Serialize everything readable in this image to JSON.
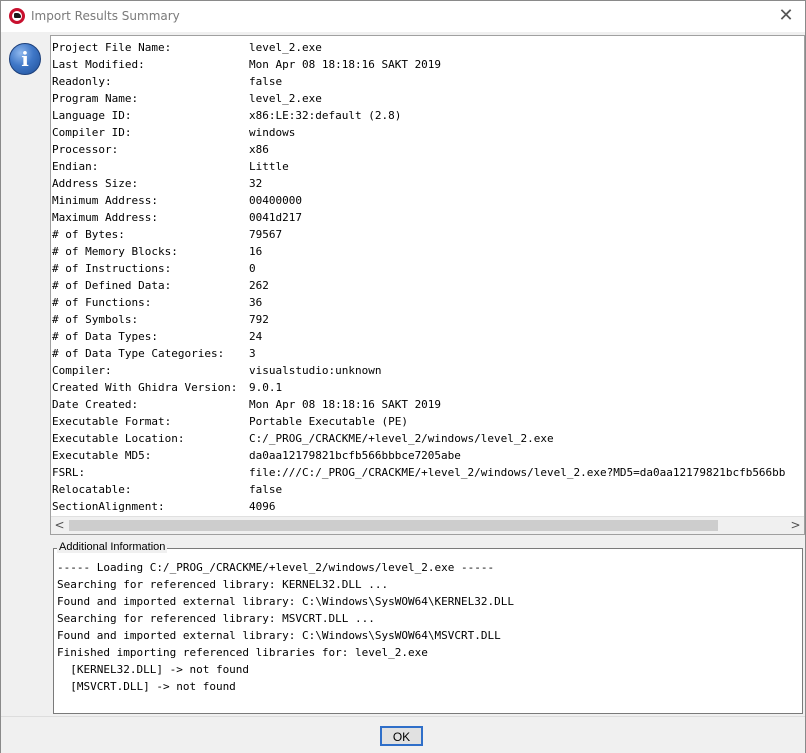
{
  "window": {
    "title": "Import Results Summary",
    "close_glyph": "✕",
    "icon": "ghidra-dragon-icon"
  },
  "info_icon_glyph": "i",
  "properties": [
    {
      "key": "Project File Name:",
      "value": "level_2.exe"
    },
    {
      "key": "Last Modified:",
      "value": "Mon Apr 08 18:18:16 SAKT 2019"
    },
    {
      "key": "Readonly:",
      "value": "false"
    },
    {
      "key": "Program Name:",
      "value": "level_2.exe"
    },
    {
      "key": "Language ID:",
      "value": "x86:LE:32:default (2.8)"
    },
    {
      "key": "Compiler ID:",
      "value": "windows"
    },
    {
      "key": "Processor:",
      "value": "x86"
    },
    {
      "key": "Endian:",
      "value": "Little"
    },
    {
      "key": "Address Size:",
      "value": "32"
    },
    {
      "key": "Minimum Address:",
      "value": "00400000"
    },
    {
      "key": "Maximum Address:",
      "value": "0041d217"
    },
    {
      "key": "# of Bytes:",
      "value": "79567"
    },
    {
      "key": "# of Memory Blocks:",
      "value": "16"
    },
    {
      "key": "# of Instructions:",
      "value": "0"
    },
    {
      "key": "# of Defined Data:",
      "value": "262"
    },
    {
      "key": "# of Functions:",
      "value": "36"
    },
    {
      "key": "# of Symbols:",
      "value": "792"
    },
    {
      "key": "# of Data Types:",
      "value": "24"
    },
    {
      "key": "# of Data Type Categories:",
      "value": "3"
    },
    {
      "key": "Compiler:",
      "value": "visualstudio:unknown"
    },
    {
      "key": "Created With Ghidra Version:",
      "value": "9.0.1"
    },
    {
      "key": "Date Created:",
      "value": "Mon Apr 08 18:18:16 SAKT 2019"
    },
    {
      "key": "Executable Format:",
      "value": "Portable Executable (PE)"
    },
    {
      "key": "Executable Location:",
      "value": "C:/_PROG_/CRACKME/+level_2/windows/level_2.exe"
    },
    {
      "key": "Executable MD5:",
      "value": "da0aa12179821bcfb566bbbce7205abe"
    },
    {
      "key": "FSRL:",
      "value": "file:///C:/_PROG_/CRACKME/+level_2/windows/level_2.exe?MD5=da0aa12179821bcfb566bb"
    },
    {
      "key": "Relocatable:",
      "value": "false"
    },
    {
      "key": "SectionAlignment:",
      "value": "4096"
    }
  ],
  "scrollbar": {
    "left_arrow": "<",
    "right_arrow": ">"
  },
  "additional": {
    "legend": "Additional Information",
    "lines": [
      "----- Loading C:/_PROG_/CRACKME/+level_2/windows/level_2.exe -----",
      "Searching for referenced library: KERNEL32.DLL ...",
      "Found and imported external library: C:\\Windows\\SysWOW64\\KERNEL32.DLL",
      "Searching for referenced library: MSVCRT.DLL ...",
      "Found and imported external library: C:\\Windows\\SysWOW64\\MSVCRT.DLL",
      "Finished importing referenced libraries for: level_2.exe",
      "  [KERNEL32.DLL] -> not found",
      "  [MSVCRT.DLL] -> not found"
    ]
  },
  "footer": {
    "ok_label": "OK"
  }
}
